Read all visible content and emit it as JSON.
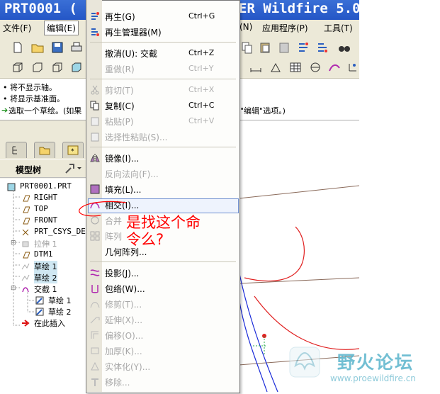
{
  "window": {
    "title_left": "PRT0001 (",
    "title_right": "ER Wildfire 5.0"
  },
  "menubar": {
    "file": "文件(F)",
    "edit": "编辑(E)",
    "n_item": "(N)",
    "apps": "应用程序(P)",
    "tools": "工具(T)"
  },
  "messages": [
    "• 将不显示轴。",
    "• 将显示基准面。",
    "选取一个草绘。(如果",
    "\"编辑\"选项。)"
  ],
  "model_tree": {
    "title": "模型树",
    "nodes": [
      {
        "label": "PRT0001.PRT",
        "icon": "part-icon"
      },
      {
        "label": "RIGHT",
        "icon": "datum-plane-icon"
      },
      {
        "label": "TOP",
        "icon": "datum-plane-icon"
      },
      {
        "label": "FRONT",
        "icon": "datum-plane-icon"
      },
      {
        "label": "PRT_CSYS_DE",
        "icon": "csys-icon"
      },
      {
        "label": "拉伸 1",
        "icon": "extrude-icon"
      },
      {
        "label": "DTM1",
        "icon": "datum-plane-icon"
      },
      {
        "label": "草绘 1",
        "icon": "sketch-icon"
      },
      {
        "label": "草绘 2",
        "icon": "sketch-icon"
      },
      {
        "label": "交截 1",
        "icon": "intersect-icon"
      },
      {
        "label": "草绘 1",
        "icon": "sketch-icon"
      },
      {
        "label": "草绘 2",
        "icon": "sketch-icon"
      },
      {
        "label": "在此插入",
        "icon": "insert-arrow-icon"
      }
    ]
  },
  "edit_menu": {
    "regenerate": {
      "label": "再生(G)",
      "shortcut": "Ctrl+G"
    },
    "regen_manager": {
      "label": "再生管理器(M)"
    },
    "undo": {
      "label": "撤消(U):  交截",
      "shortcut": "Ctrl+Z"
    },
    "redo": {
      "label": "重做(R)",
      "shortcut": "Ctrl+Y"
    },
    "cut": {
      "label": "剪切(T)",
      "shortcut": "Ctrl+X"
    },
    "copy": {
      "label": "复制(C)",
      "shortcut": "Ctrl+C"
    },
    "paste": {
      "label": "粘贴(P)",
      "shortcut": "Ctrl+V"
    },
    "paste_special": {
      "label": "选择性粘贴(S)..."
    },
    "mirror": {
      "label": "镜像(I)..."
    },
    "reverse_normal": {
      "label": "反向法向(F)..."
    },
    "fill": {
      "label": "填充(L)..."
    },
    "intersect": {
      "label": "相交(I)..."
    },
    "merge": {
      "label": "合并"
    },
    "pattern": {
      "label": "阵列"
    },
    "geom_pattern": {
      "label": "几何阵列..."
    },
    "project": {
      "label": "投影(J)..."
    },
    "wrap": {
      "label": "包络(W)..."
    },
    "trim": {
      "label": "修剪(T)..."
    },
    "extend": {
      "label": "延伸(X)..."
    },
    "offset": {
      "label": "偏移(O)..."
    },
    "thicken": {
      "label": "加厚(K)..."
    },
    "solidify": {
      "label": "实体化(Y)..."
    },
    "remove": {
      "label": "移除..."
    }
  },
  "annotation": {
    "line1": "是找这个命",
    "line2": "令么?"
  },
  "watermark": {
    "text": "野火论坛",
    "url": "www.proewildfire.cn"
  },
  "colors": {
    "titlebar": "#2a5fcf",
    "annotation": "#ff0000",
    "watermark": "#5ab4cc",
    "selection": "#cfe7f2"
  }
}
